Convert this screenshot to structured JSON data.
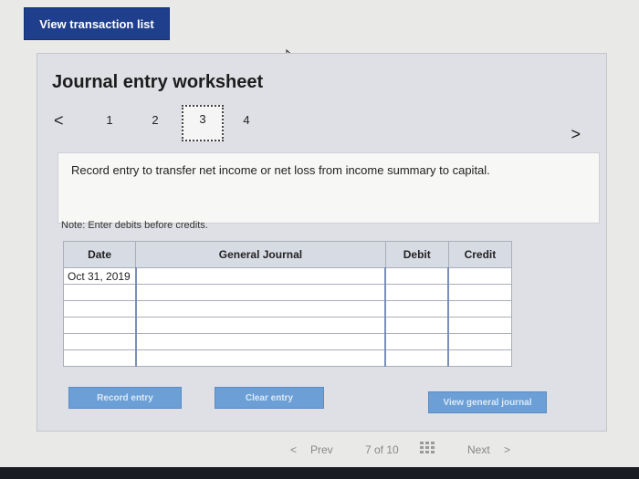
{
  "header": {
    "view_list_label": "View transaction list"
  },
  "worksheet": {
    "title": "Journal entry worksheet",
    "tabs": [
      "1",
      "2",
      "3",
      "4"
    ],
    "active_tab": "3",
    "prev_tab_glyph": "<",
    "next_tab_glyph": ">",
    "instruction": "Record entry to transfer net income or net loss from income summary to capital.",
    "note": "Note: Enter debits before credits."
  },
  "journal": {
    "columns": [
      "Date",
      "General Journal",
      "Debit",
      "Credit"
    ],
    "rows": [
      {
        "date": "Oct 31, 2019",
        "account": "",
        "debit": "",
        "credit": ""
      },
      {
        "date": "",
        "account": "",
        "debit": "",
        "credit": ""
      },
      {
        "date": "",
        "account": "",
        "debit": "",
        "credit": ""
      },
      {
        "date": "",
        "account": "",
        "debit": "",
        "credit": ""
      },
      {
        "date": "",
        "account": "",
        "debit": "",
        "credit": ""
      },
      {
        "date": "",
        "account": "",
        "debit": "",
        "credit": ""
      }
    ]
  },
  "actions": {
    "record_label": "Record entry",
    "clear_label": "Clear entry",
    "view_journal_label": "View general journal"
  },
  "pager": {
    "prev_label": "Prev",
    "position": "7 of 10",
    "next_label": "Next",
    "prev_glyph": "<",
    "next_glyph": ">"
  },
  "colors": {
    "primary_button": "#1f3f8c",
    "action_button": "#6b9fd6",
    "panel": "#dfe0e5"
  }
}
